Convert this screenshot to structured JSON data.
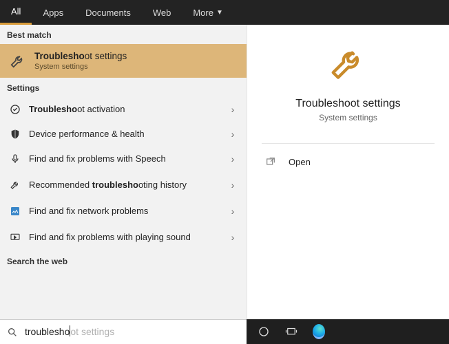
{
  "tabs": {
    "all": "All",
    "apps": "Apps",
    "documents": "Documents",
    "web": "Web",
    "more": "More"
  },
  "headers": {
    "best": "Best match",
    "settings": "Settings",
    "web": "Search the web"
  },
  "best": {
    "title_bold": "Troublesho",
    "title_rest": "ot settings",
    "sub": "System settings"
  },
  "items": {
    "activation_bold": "Troublesho",
    "activation_rest": "ot activation",
    "device": "Device performance & health",
    "speech": "Find and fix problems with Speech",
    "rec_pre": "Recommended ",
    "rec_bold": "troublesho",
    "rec_rest": "oting history",
    "network": "Find and fix network problems",
    "sound": "Find and fix problems with playing sound"
  },
  "preview": {
    "title": "Troubleshoot settings",
    "sub": "System settings",
    "open": "Open"
  },
  "search": {
    "typed": "troublesho",
    "ghost": "ot settings"
  }
}
